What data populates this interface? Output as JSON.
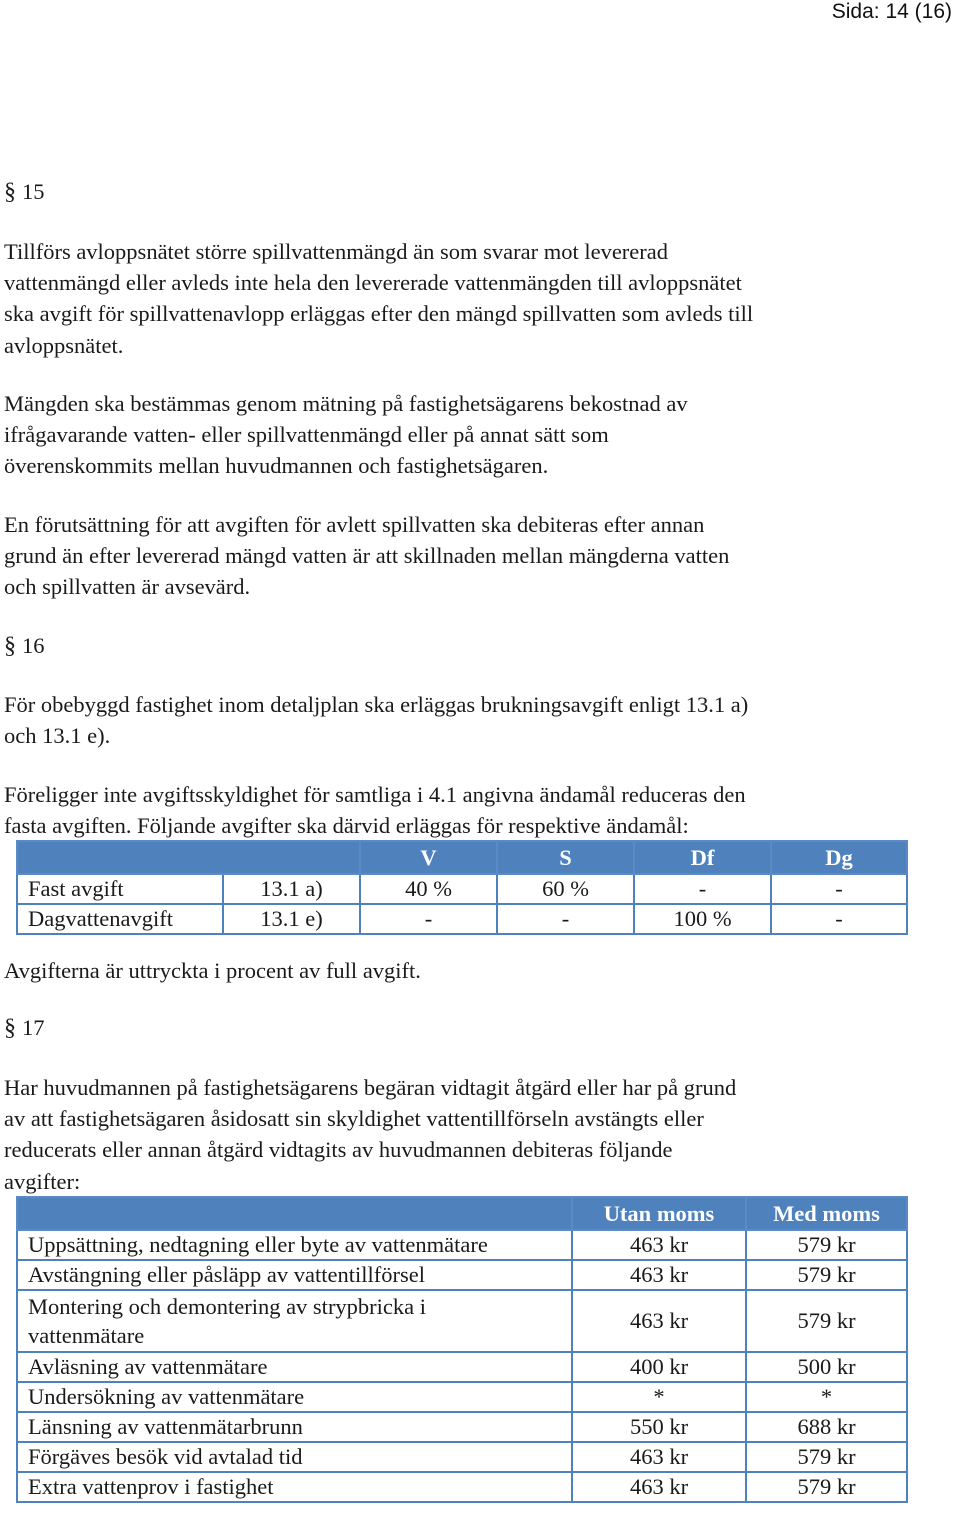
{
  "header": {
    "page_label": "Sida: 14 (16)"
  },
  "section_15": {
    "heading_symbol": "§",
    "heading_number": "15",
    "paragraphs": [
      [
        "Tillförs avloppsnätet större spillvattenmängd än som svarar mot levererad",
        "vattenmängd eller avleds inte hela den levererade vattenmängden till avloppsnätet",
        "ska avgift för spillvattenavlopp erläggas efter den mängd spillvatten som avleds till",
        "avloppsnätet."
      ],
      [
        "Mängden ska bestämmas genom mätning på fastighetsägarens bekostnad av",
        "ifrågavarande vatten- eller spillvattenmängd eller på annat sätt som",
        "överenskommits mellan huvudmannen och fastighetsägaren."
      ],
      [
        "En förutsättning för att avgiften för avlett spillvatten ska debiteras efter annan",
        "grund än efter levererad mängd vatten är att skillnaden mellan mängderna vatten",
        "och spillvatten är avsevärd."
      ]
    ]
  },
  "section_16": {
    "heading_symbol": "§",
    "heading_number": "16",
    "paragraphs": [
      [
        "För obebyggd fastighet inom detaljplan ska erläggas brukningsavgift enligt 13.1 a)",
        "och 13.1 e)."
      ],
      [
        "Föreligger inte avgiftsskyldighet för samtliga i 4.1 angivna ändamål reduceras den",
        "fasta avgiften. Följande avgifter ska därvid erläggas för respektive ändamål:"
      ]
    ],
    "table": {
      "headers": [
        "",
        "",
        "V",
        "S",
        "Df",
        "Dg"
      ],
      "rows": [
        [
          "Fast avgift",
          "13.1 a)",
          "40 %",
          "60 %",
          "-",
          "-"
        ],
        [
          "Dagvattenavgift",
          "13.1 e)",
          "-",
          "-",
          "100 %",
          "-"
        ]
      ]
    },
    "note": "Avgifterna är uttryckta i procent av full avgift."
  },
  "section_17": {
    "heading_symbol": "§",
    "heading_number": "17",
    "paragraphs": [
      [
        "Har huvudmannen på fastighetsägarens begäran vidtagit åtgärd eller har på grund",
        "av att fastighetsägaren åsidosatt sin skyldighet vattentillförseln avstängts eller",
        "reducerats eller annan åtgärd vidtagits av huvudmannen debiteras följande",
        "avgifter:"
      ]
    ],
    "table": {
      "headers": [
        "",
        "Utan moms",
        "Med moms"
      ],
      "rows": [
        [
          "Uppsättning, nedtagning eller byte av vattenmätare",
          "463 kr",
          "579 kr"
        ],
        [
          "Avstängning eller påsläpp av vattentillförsel",
          "463 kr",
          "579 kr"
        ],
        [
          "Montering och demontering av strypbricka i vattenmätare",
          "463 kr",
          "579 kr"
        ],
        [
          "Avläsning av vattenmätare",
          "400 kr",
          "500 kr"
        ],
        [
          "Undersökning av vattenmätare",
          "*",
          "*"
        ],
        [
          "Länsning av vattenmätarbrunn",
          "550 kr",
          "688 kr"
        ],
        [
          "Förgäves besök vid avtalad tid",
          "463 kr",
          "579 kr"
        ],
        [
          "Extra vattenprov i fastighet",
          "463 kr",
          "579 kr"
        ]
      ]
    }
  },
  "colors": {
    "table_header_bg": "#4f81bd",
    "table_border": "#4f81bd",
    "table_header_text": "#ffffff"
  }
}
